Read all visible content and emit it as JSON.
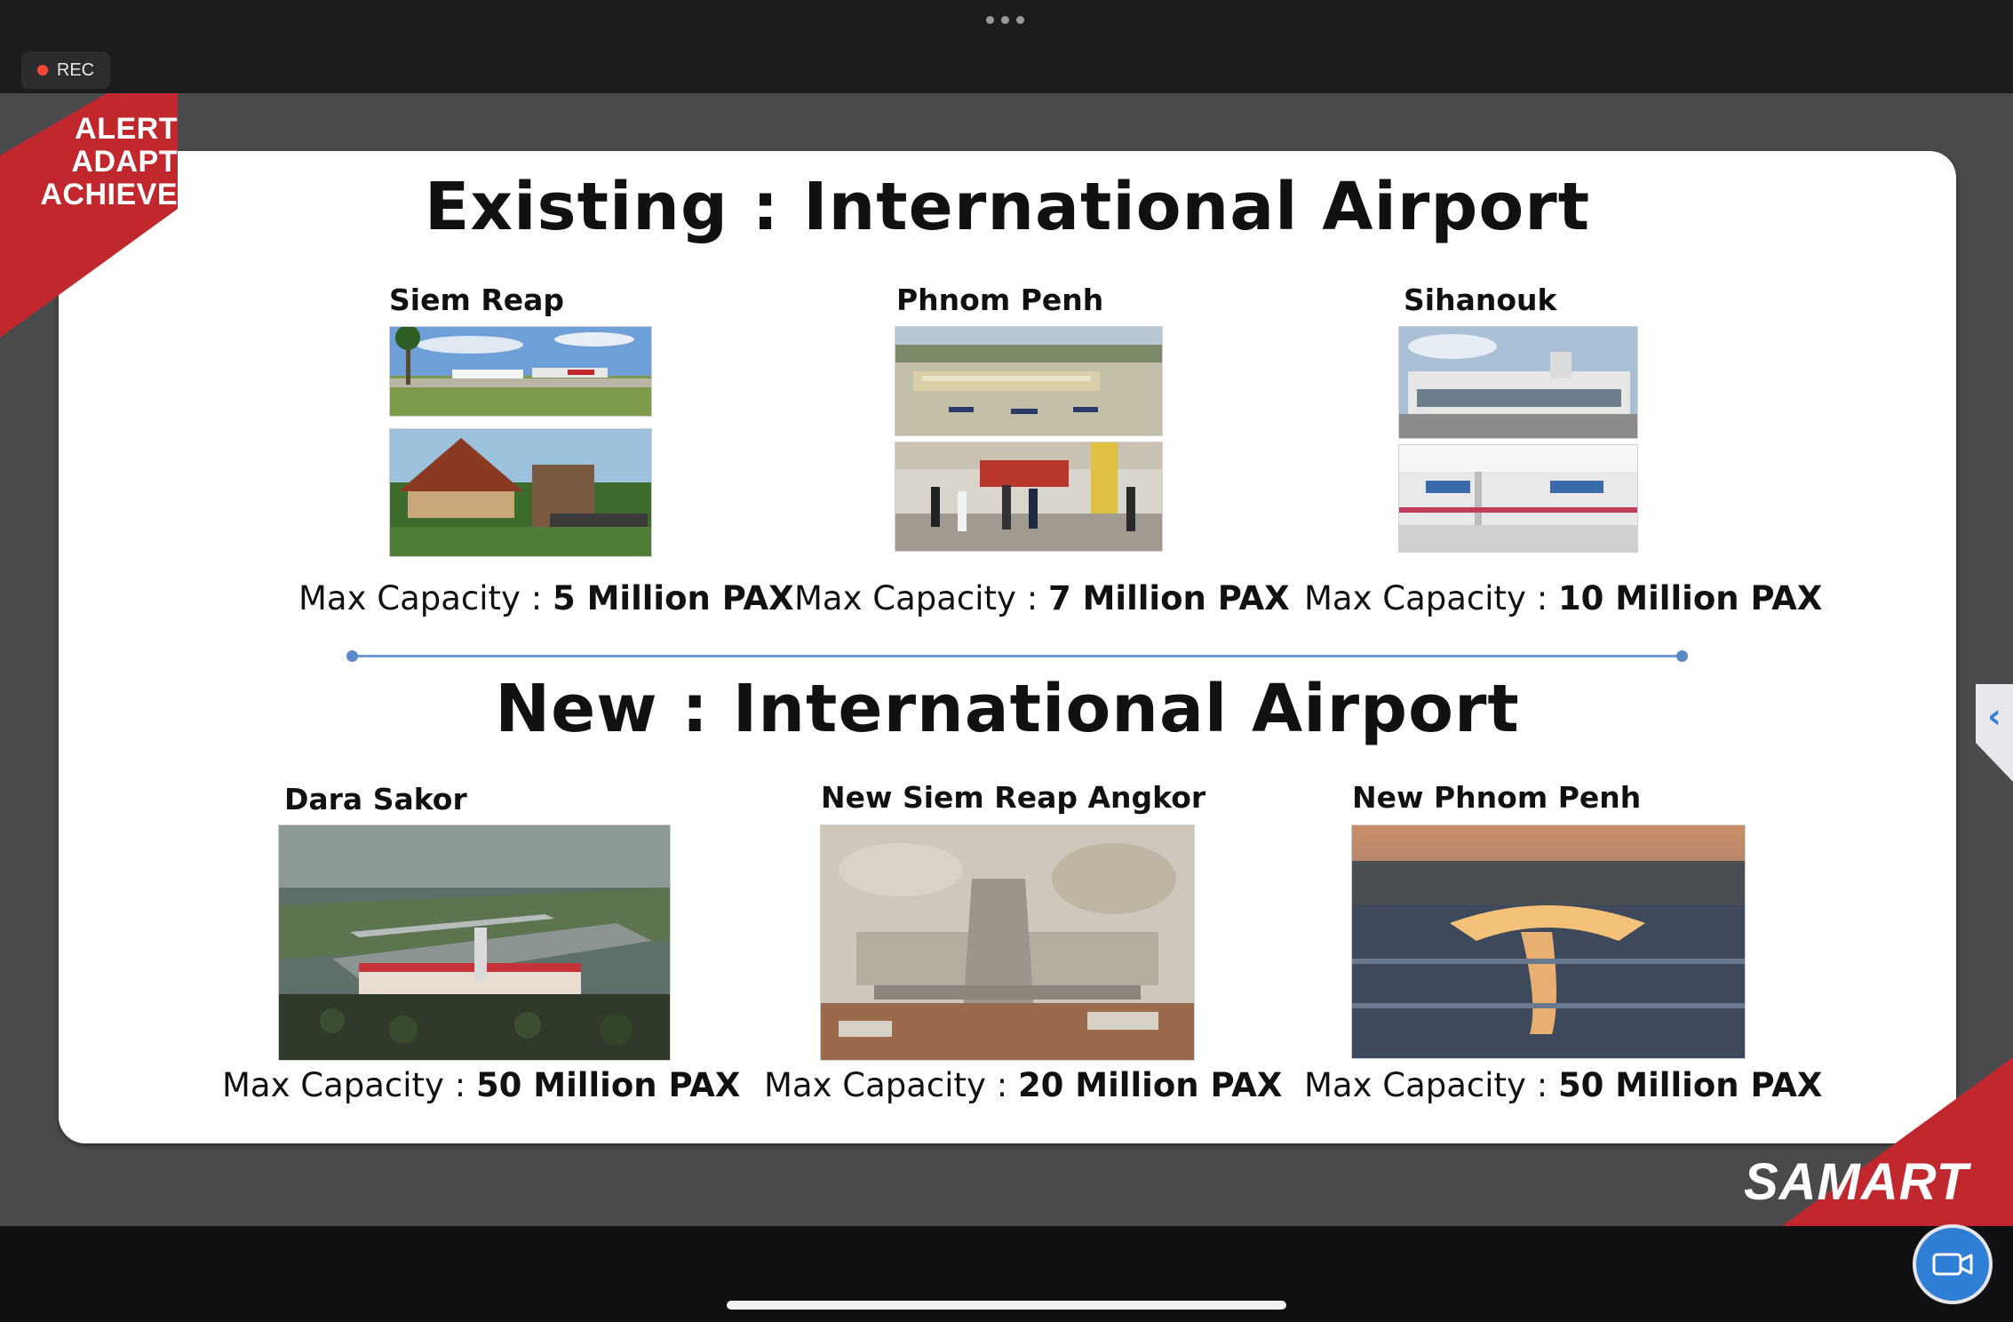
{
  "window": {
    "recording_label": "REC",
    "recording_color": "#ff453a"
  },
  "slide": {
    "banner_lines": [
      "ALERT",
      "ADAPT",
      "ACHIEVE"
    ],
    "brand": "SAMART",
    "existing_heading": "Existing : International Airport",
    "new_heading": "New : International Airport",
    "capacity_label": "Max Capacity : ",
    "existing": [
      {
        "name": "Siem Reap",
        "capacity": "5 Million PAX"
      },
      {
        "name": "Phnom Penh",
        "capacity": "7 Million PAX"
      },
      {
        "name": "Sihanouk",
        "capacity": "10 Million PAX"
      }
    ],
    "new": [
      {
        "name": "Dara Sakor",
        "capacity": "50 Million PAX"
      },
      {
        "name": "New Siem Reap Angkor",
        "capacity": "20 Million PAX"
      },
      {
        "name": "New Phnom Penh",
        "capacity": "50 Million PAX"
      }
    ]
  },
  "icons": {
    "menu": "more-dots-icon",
    "side_tab": "chevron-left-icon",
    "camera": "video-camera-icon"
  }
}
